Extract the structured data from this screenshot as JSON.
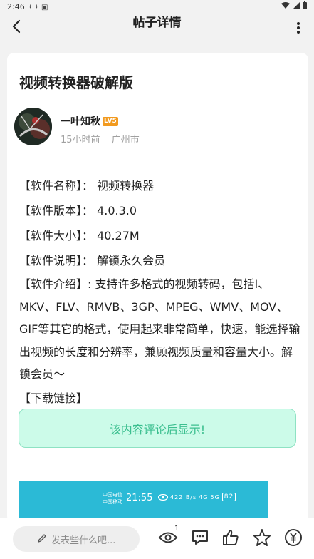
{
  "status_bar": {
    "time": "2:46"
  },
  "header": {
    "title": "帖子详情"
  },
  "post": {
    "title": "视频转换器破解版",
    "author": {
      "name": "一叶知秋",
      "level": "LV5"
    },
    "time_ago": "15小时前",
    "location": "广州市",
    "lines": [
      "【软件名称】： 视频转换器",
      "【软件版本】： 4.0.3.0",
      "【软件大小】： 40.27M",
      "【软件说明】： 解锁永久会员"
    ],
    "intro": "【软件介绍】: 支持许多格式的视频转码，包括I、MKV、FLV、RMVB、3GP、MPEG、WMV、MOV、GIF等其它的格式，使用起来非常简单，快速，能选择输出视频的长度和分辨率，兼顾视频质量和容量大小。解锁会员～",
    "download_label": "【下载链接】",
    "locked_text": "该内容评论后显示!"
  },
  "screenshot": {
    "carrier1": "中国电信",
    "carrier2": "中国移动",
    "time": "21:55",
    "speed": "422 B/s",
    "net1": "4G",
    "net2": "5G",
    "battery": "82"
  },
  "bottom_bar": {
    "comment_placeholder": "发表些什么吧...",
    "view_count": "1"
  },
  "colors": {
    "accent_green": "#3bbf8f",
    "badge_orange": "#f29a1f",
    "locked_bg": "#ccfbe9"
  }
}
